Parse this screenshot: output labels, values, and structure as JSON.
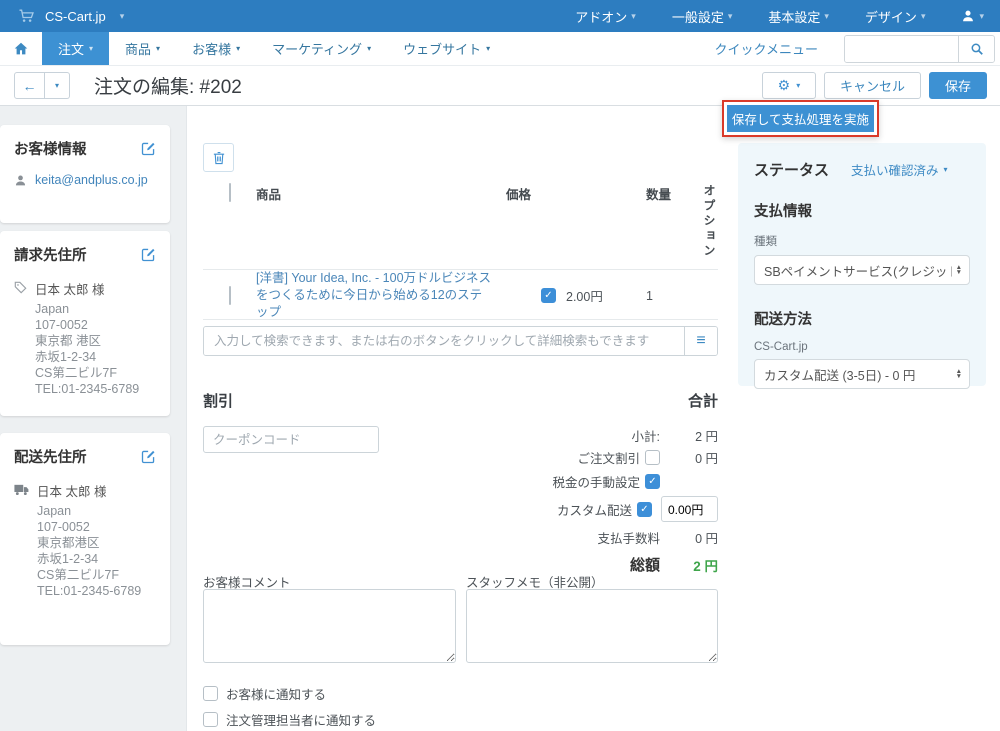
{
  "icons": {
    "caret_down": "▾",
    "gear": "⚙",
    "back_arrow": "←",
    "hamburger": "≡",
    "check": "✓",
    "select_up": "▲",
    "select_down": "▼"
  },
  "colors": {
    "topbar_bg": "#2d7dc0",
    "primary": "#3d91d3",
    "link": "#3c87bd",
    "annotation_red": "#d93a2a",
    "total_green": "#3fa54b",
    "status_panel_bg": "#eff7fb"
  },
  "topbar": {
    "brand": "CS-Cart.jp",
    "menus": [
      {
        "label": "アドオン"
      },
      {
        "label": "一般設定"
      },
      {
        "label": "基本設定"
      },
      {
        "label": "デザイン"
      }
    ]
  },
  "navbar": {
    "items": [
      {
        "label": "注文"
      },
      {
        "label": "商品"
      },
      {
        "label": "お客様"
      },
      {
        "label": "マーケティング"
      },
      {
        "label": "ウェブサイト"
      }
    ],
    "quick_menu": "クイックメニュー",
    "search_placeholder": ""
  },
  "header": {
    "title": "注文の編集: #202",
    "cancel": "キャンセル",
    "save": "保存",
    "save_dropdown_item": "保存して支払処理を実施"
  },
  "sidebar": {
    "customer": {
      "title": "お客様情報",
      "email": "keita@andplus.co.jp"
    },
    "billing": {
      "title": "請求先住所",
      "name": "日本 太郎 様",
      "lines": [
        "Japan",
        "107-0052",
        "東京都 港区",
        "赤坂1-2-34",
        "CS第二ビル7F",
        "TEL:01-2345-6789"
      ]
    },
    "shipping": {
      "title": "配送先住所",
      "name": "日本 太郎 様",
      "lines": [
        "Japan",
        "107-0052",
        "東京都港区",
        "赤坂1-2-34",
        "CS第二ビル7F",
        "TEL:01-2345-6789"
      ]
    }
  },
  "products": {
    "columns": {
      "product": "商品",
      "price": "価格",
      "quantity": "数量",
      "options": "オプション"
    },
    "rows": [
      {
        "name": "[洋書] Your Idea, Inc. - 100万ドルビジネスをつくるために今日から始める12のステップ",
        "price": "2.00円",
        "quantity": "1"
      }
    ],
    "search_placeholder": "入力して検索できます、または右のボタンをクリックして詳細検索もできます"
  },
  "totals": {
    "discount_title": "割引",
    "coupon_placeholder": "クーポンコード",
    "total_title": "合計",
    "subtotal_label": "小計:",
    "subtotal_value": "2 円",
    "order_discount_label": "ご注文割引",
    "order_discount_value": "0 円",
    "manual_tax_label": "税金の手動設定",
    "custom_shipping_label": "カスタム配送",
    "custom_shipping_value": "0.00円",
    "payment_fee_label": "支払手数料",
    "payment_fee_value": "0 円",
    "grand_total_label": "総額",
    "grand_total_value": "2 円"
  },
  "comments": {
    "customer_label": "お客様コメント",
    "staff_label": "スタッフメモ（非公開）",
    "notify_customer": "お客様に通知する",
    "notify_manager": "注文管理担当者に通知する"
  },
  "status_panel": {
    "status_title": "ステータス",
    "status_value": "支払い確認済み",
    "payment_title": "支払情報",
    "payment_type_label": "種類",
    "payment_type_value": "SBペイメントサービス(クレジットカード",
    "shipping_title": "配送方法",
    "shipping_carrier": "CS-Cart.jp",
    "shipping_value": "カスタム配送 (3-5日) - 0 円"
  }
}
